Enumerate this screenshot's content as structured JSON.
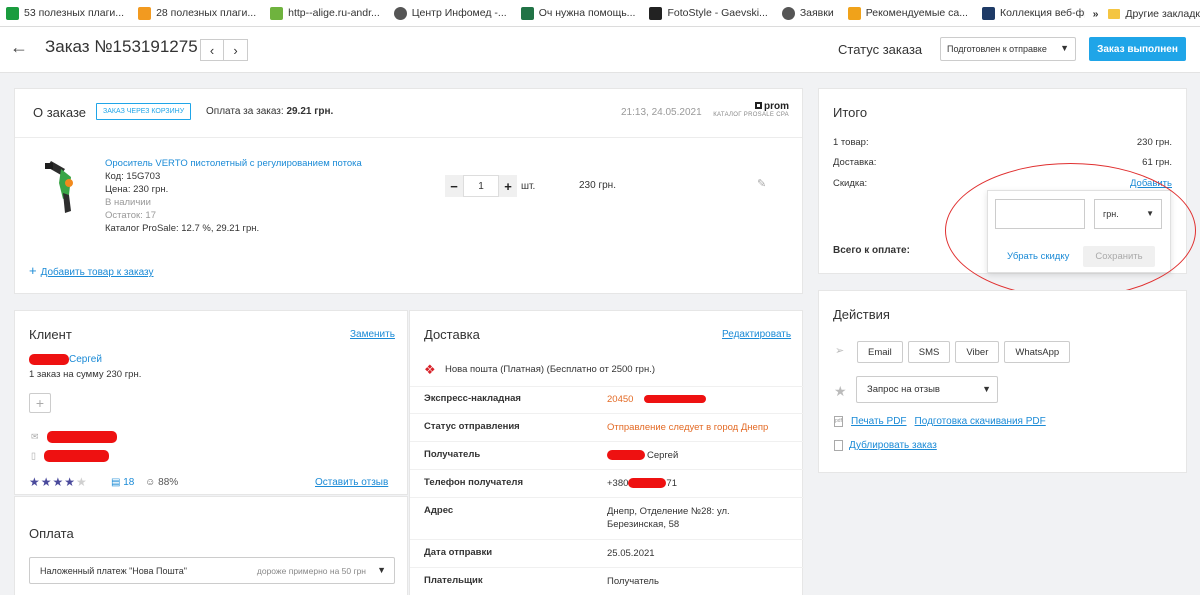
{
  "bookmarks": [
    {
      "label": "53 полезных плаги...",
      "color": "#1a9c3e"
    },
    {
      "label": "28 полезных плаги...",
      "color": "#f29a20"
    },
    {
      "label": "http--alige.ru-andr...",
      "color": "#6fb33e"
    },
    {
      "label": "Центр Инфомед -...",
      "color": "#555555"
    },
    {
      "label": "Оч нужна помощь...",
      "color": "#217346"
    },
    {
      "label": "FotoStyle - Gaevski...",
      "color": "#222222"
    },
    {
      "label": "Заявки",
      "color": "#555555"
    },
    {
      "label": "Рекомендуемые са...",
      "color": "#f0a21a"
    },
    {
      "label": "Коллекция веб-фр...",
      "color": "#1e3a66"
    }
  ],
  "bookmarks_more": "»",
  "bookmarks_other": "Другие закладк",
  "header": {
    "back_icon": "←",
    "title": "Заказ №153191275",
    "prev": "‹",
    "next": "›",
    "status_label": "Статус заказа",
    "status_value": "Подготовлен к отправке",
    "done_button": "Заказ выполнен"
  },
  "about": {
    "title": "О заказе",
    "badge": "ЗАКАЗ ЧЕРЕЗ КОРЗИНУ",
    "pay_prefix": "Оплата за заказ:",
    "pay_amount": "29.21 грн.",
    "datetime": "21:13, 24.05.2021",
    "brand": "prom",
    "brand_sub": "КАТАЛОГ PROSALE CPA",
    "product": {
      "name": "Ороситель VERTO пистолетный с регулированием потока",
      "code": "Код: 15G703",
      "price": "Цена: 230 грн.",
      "availability": "В наличии",
      "stock": "Остаток: 17",
      "catalog": "Каталог ProSale: 12.7 %, 29.21 грн.",
      "qty": "1",
      "unit": "шт.",
      "sum": "230 грн."
    },
    "add_product": "Добавить товар к заказу"
  },
  "totals": {
    "title": "Итого",
    "rows": [
      {
        "label": "1 товар:",
        "value": "230 грн."
      },
      {
        "label": "Доставка:",
        "value": "61 грн."
      },
      {
        "label": "Скидка:",
        "value": "Добавить"
      }
    ],
    "total_label": "Всего к оплате:",
    "popup": {
      "input_value": "",
      "currency": "грн.",
      "remove": "Убрать скидку",
      "save": "Сохранить"
    }
  },
  "actions": {
    "title": "Действия",
    "buttons": [
      "Email",
      "SMS",
      "Viber",
      "WhatsApp"
    ],
    "review_select": "Запрос на отзыв",
    "print_pdf": "Печать PDF",
    "prepare_pdf": "Подготовка скачивания PDF",
    "duplicate": "Дублировать заказ"
  },
  "client": {
    "title": "Клиент",
    "change": "Заменить",
    "name": "Сергей",
    "orders": "1 заказ на сумму 230 грн.",
    "rating_stars": 4,
    "reviews": "18",
    "percent": "88%",
    "leave_review": "Оставить отзыв"
  },
  "payment": {
    "title": "Оплата",
    "method": "Наложенный платеж \"Нова Пошта\"",
    "hint": "дороже примерно на 50 грн"
  },
  "delivery": {
    "title": "Доставка",
    "edit": "Редактировать",
    "carrier": "Нова пошта (Платная) (Бесплатно от 2500 грн.)",
    "rows": [
      {
        "label": "Экспресс-накладная",
        "value": "20450"
      },
      {
        "label": "Статус отправления",
        "value": "Отправление следует в город Днепр"
      },
      {
        "label": "Получатель",
        "value": "Сергей"
      },
      {
        "label": "Телефон получателя",
        "value": "+380"
      },
      {
        "label": "Адрес",
        "value": "Днепр, Отделение №28: ул. Березинская, 58"
      },
      {
        "label": "Дата отправки",
        "value": "25.05.2021"
      },
      {
        "label": "Плательщик",
        "value": "Получатель"
      }
    ],
    "phone_suffix": "71"
  }
}
